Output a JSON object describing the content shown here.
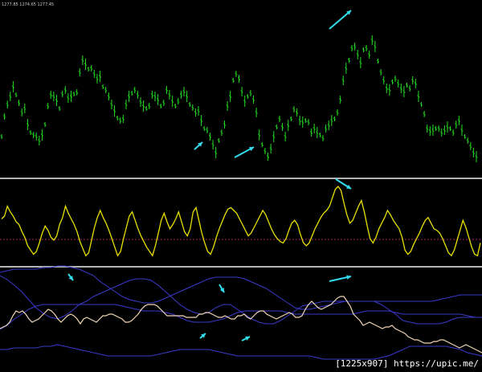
{
  "header": {
    "ohlc_text": "1277.85 1274.65 1277.45"
  },
  "watermark": "[1225x907] https://upic.me/",
  "colors": {
    "background": "#000000",
    "price_bars": "#22dd22",
    "oscillator": "#e8e000",
    "oscillator_level": "#aa2255",
    "close_line": "#f2d7b8",
    "bands": "#3a3acc",
    "separator": "#b4b4b4",
    "arrows": "#33ddee"
  },
  "chart_data": [
    {
      "type": "line",
      "panel": "price",
      "series": [
        {
          "values": [
            150,
            125,
            110,
            100,
            88,
            98,
            108,
            120,
            115,
            135,
            145,
            148,
            150,
            155,
            148,
            135,
            112,
            98,
            100,
            105,
            115,
            97,
            92,
            102,
            100,
            97,
            95,
            70,
            55,
            60,
            66,
            65,
            72,
            78,
            75,
            88,
            92,
            100,
            110,
            118,
            127,
            130,
            128,
            110,
            100,
            96,
            92,
            98,
            107,
            112,
            115,
            112,
            98,
            100,
            104,
            112,
            108,
            92,
            98,
            106,
            112,
            106,
            98,
            94,
            100,
            110,
            114,
            120,
            118,
            130,
            140,
            142,
            150,
            160,
            170,
            155,
            145,
            135,
            112,
            100,
            80,
            72,
            78,
            94,
            106,
            100,
            96,
            104,
            120,
            148,
            160,
            168,
            175,
            165,
            150,
            138,
            128,
            138,
            150,
            136,
            128,
            116,
            120,
            130,
            132,
            130,
            132,
            145,
            140,
            145,
            148,
            152,
            140,
            136,
            130,
            128,
            120,
            104,
            80,
            65,
            55,
            40,
            38,
            48,
            58,
            42,
            40,
            48,
            30,
            38,
            56,
            70,
            80,
            90,
            92,
            82,
            78,
            84,
            90,
            94,
            86,
            90,
            80,
            84,
            100,
            110,
            122,
            140,
            143,
            142,
            140,
            140,
            145,
            142,
            138,
            140,
            145,
            135,
            130,
            142,
            150,
            155,
            162,
            170,
            175
          ]
        }
      ]
    },
    {
      "type": "line",
      "panel": "oscillator",
      "ylim": [
        0,
        100
      ],
      "reference_level": 25,
      "series": [
        {
          "values": [
            54,
            58,
            72,
            64,
            58,
            50,
            46,
            36,
            28,
            16,
            10,
            4,
            8,
            20,
            34,
            44,
            38,
            28,
            24,
            30,
            46,
            56,
            72,
            62,
            54,
            46,
            36,
            22,
            12,
            2,
            6,
            24,
            42,
            56,
            66,
            56,
            48,
            38,
            26,
            14,
            2,
            8,
            26,
            42,
            58,
            64,
            52,
            40,
            30,
            22,
            14,
            8,
            2,
            16,
            34,
            52,
            62,
            50,
            40,
            46,
            54,
            64,
            50,
            36,
            30,
            40,
            64,
            70,
            52,
            34,
            20,
            8,
            4,
            14,
            28,
            40,
            50,
            60,
            68,
            70,
            66,
            62,
            54,
            46,
            38,
            30,
            34,
            42,
            50,
            58,
            66,
            60,
            50,
            40,
            32,
            26,
            22,
            20,
            26,
            38,
            48,
            52,
            46,
            32,
            20,
            16,
            20,
            30,
            40,
            48,
            56,
            62,
            66,
            72,
            84,
            96,
            100,
            94,
            76,
            60,
            48,
            52,
            62,
            72,
            80,
            64,
            44,
            26,
            20,
            28,
            40,
            48,
            56,
            66,
            60,
            52,
            46,
            40,
            28,
            10,
            4,
            8,
            18,
            26,
            34,
            44,
            52,
            56,
            48,
            40,
            38,
            34,
            26,
            16,
            6,
            2,
            10,
            24,
            38,
            52,
            42,
            28,
            14,
            4,
            2,
            20
          ]
        }
      ]
    },
    {
      "type": "line",
      "panel": "bands",
      "series": [
        {
          "values": [
            8,
            13,
            20,
            28,
            38,
            48,
            55,
            60,
            62,
            58,
            52,
            44,
            40,
            34,
            30,
            26,
            22,
            18,
            14,
            12,
            12,
            14,
            20,
            28,
            36,
            44,
            50,
            54,
            56,
            54,
            48,
            44,
            44,
            50,
            56,
            62,
            66,
            68,
            68,
            64,
            58,
            52,
            46,
            44,
            42,
            40,
            40,
            40,
            40,
            40,
            40,
            40,
            40,
            44,
            50,
            56,
            64,
            66,
            68,
            68,
            68,
            68,
            66,
            62,
            60,
            60,
            60,
            60
          ]
        },
        {
          "values": [
            75,
            70,
            62,
            56,
            50,
            46,
            44,
            44,
            44,
            44,
            44,
            44,
            44,
            44,
            44,
            44,
            44,
            46,
            48,
            50,
            52,
            52,
            52,
            54,
            56,
            60,
            64,
            66,
            66,
            66,
            64,
            62,
            58,
            54,
            52,
            52,
            52,
            52,
            52,
            52,
            54,
            56,
            56,
            56,
            56,
            56,
            56,
            56,
            56,
            56,
            54,
            52,
            52,
            52,
            52,
            54,
            56,
            56,
            56,
            56,
            56,
            56,
            56,
            56,
            56,
            58,
            60,
            60
          ]
        },
        {
          "values": [
            100,
            100,
            98,
            98,
            98,
            98,
            96,
            96,
            94,
            96,
            98,
            100,
            102,
            104,
            106,
            108,
            108,
            108,
            108,
            108,
            108,
            108,
            106,
            104,
            102,
            100,
            100,
            100,
            100,
            100,
            102,
            104,
            106,
            108,
            108,
            108,
            108,
            108,
            108,
            108,
            108,
            108,
            108,
            108,
            110,
            112,
            112,
            112,
            112,
            112,
            112,
            112,
            112,
            110,
            108,
            104,
            100,
            96,
            96,
            96,
            96,
            96,
            96,
            98,
            100,
            104,
            106,
            108
          ]
        },
        {
          "values": [
            4,
            2,
            0,
            0,
            0,
            0,
            -2,
            -2,
            -4,
            -4,
            -2,
            0,
            4,
            8,
            16,
            22,
            28,
            34,
            38,
            40,
            42,
            42,
            40,
            36,
            32,
            28,
            24,
            20,
            16,
            12,
            10,
            10,
            10,
            10,
            12,
            16,
            20,
            24,
            30,
            36,
            42,
            48,
            50,
            50,
            48,
            46,
            44,
            42,
            40,
            40,
            40,
            40,
            40,
            40,
            40,
            40,
            40,
            40,
            40,
            40,
            40,
            38,
            36,
            34,
            32,
            32,
            32,
            32
          ]
        },
        {
          "values": [
            74,
            72,
            70,
            66,
            58,
            52,
            54,
            52,
            56,
            62,
            66,
            64,
            62,
            58,
            54,
            50,
            52,
            56,
            62,
            66,
            62,
            58,
            56,
            58,
            62,
            68,
            62,
            60,
            62,
            64,
            66,
            62,
            58,
            58,
            56,
            56,
            58,
            60,
            62,
            66,
            66,
            64,
            60,
            56,
            50,
            46,
            44,
            44,
            44,
            46,
            50,
            54,
            58,
            58,
            58,
            58,
            58,
            58,
            60,
            60,
            60,
            60,
            56,
            56,
            54,
            54,
            56,
            58,
            60,
            60,
            58,
            60,
            62,
            62,
            58,
            58,
            56,
            60,
            62,
            58,
            54,
            52,
            52,
            56,
            58,
            60,
            62,
            60,
            58,
            56,
            54,
            56,
            60,
            60,
            58,
            50,
            44,
            40,
            44,
            48,
            50,
            48,
            46,
            44,
            40,
            36,
            34,
            34,
            40,
            46,
            56,
            60,
            64,
            70,
            68,
            66,
            68,
            70,
            72,
            74,
            72,
            72,
            70,
            74,
            76,
            78,
            80,
            84,
            86,
            88,
            88,
            90,
            92,
            92,
            92,
            90,
            90,
            88,
            88,
            90,
            92,
            94,
            96,
            98,
            96,
            94,
            96,
            98,
            100,
            102,
            104
          ]
        },
        {
          "values": [
            40,
            38,
            40,
            44,
            42,
            38,
            30,
            26,
            20,
            16,
            12,
            10,
            10,
            12,
            14,
            16,
            18,
            20,
            24,
            28,
            26,
            24,
            24,
            22,
            20,
            22,
            24,
            26,
            28,
            28,
            30,
            32,
            34,
            34,
            32,
            30,
            32,
            30,
            28,
            30,
            36,
            42,
            40,
            44,
            40,
            36,
            34,
            30,
            34,
            30,
            28,
            26,
            26,
            30,
            32,
            34,
            36,
            34,
            30,
            34,
            32,
            28,
            30,
            28,
            26,
            26,
            30,
            34,
            36,
            40,
            38,
            34,
            36,
            34,
            32,
            30,
            28,
            26,
            26,
            28,
            30,
            30,
            32,
            34,
            38,
            42,
            44,
            46,
            48,
            50,
            54,
            54,
            56,
            58,
            56,
            48,
            40,
            40,
            44,
            48,
            52,
            50,
            48,
            46,
            44,
            42,
            40,
            34,
            26,
            20,
            14,
            10,
            10,
            12,
            14,
            16,
            16,
            14,
            14,
            12,
            10,
            10,
            12,
            16,
            20,
            22,
            22,
            20,
            18,
            16,
            16,
            16,
            16,
            18,
            20,
            24,
            26,
            28,
            30,
            30,
            28,
            28,
            30,
            26,
            24,
            26,
            28,
            30,
            30,
            28,
            26,
            28,
            34,
            40
          ]
        }
      ]
    }
  ]
}
